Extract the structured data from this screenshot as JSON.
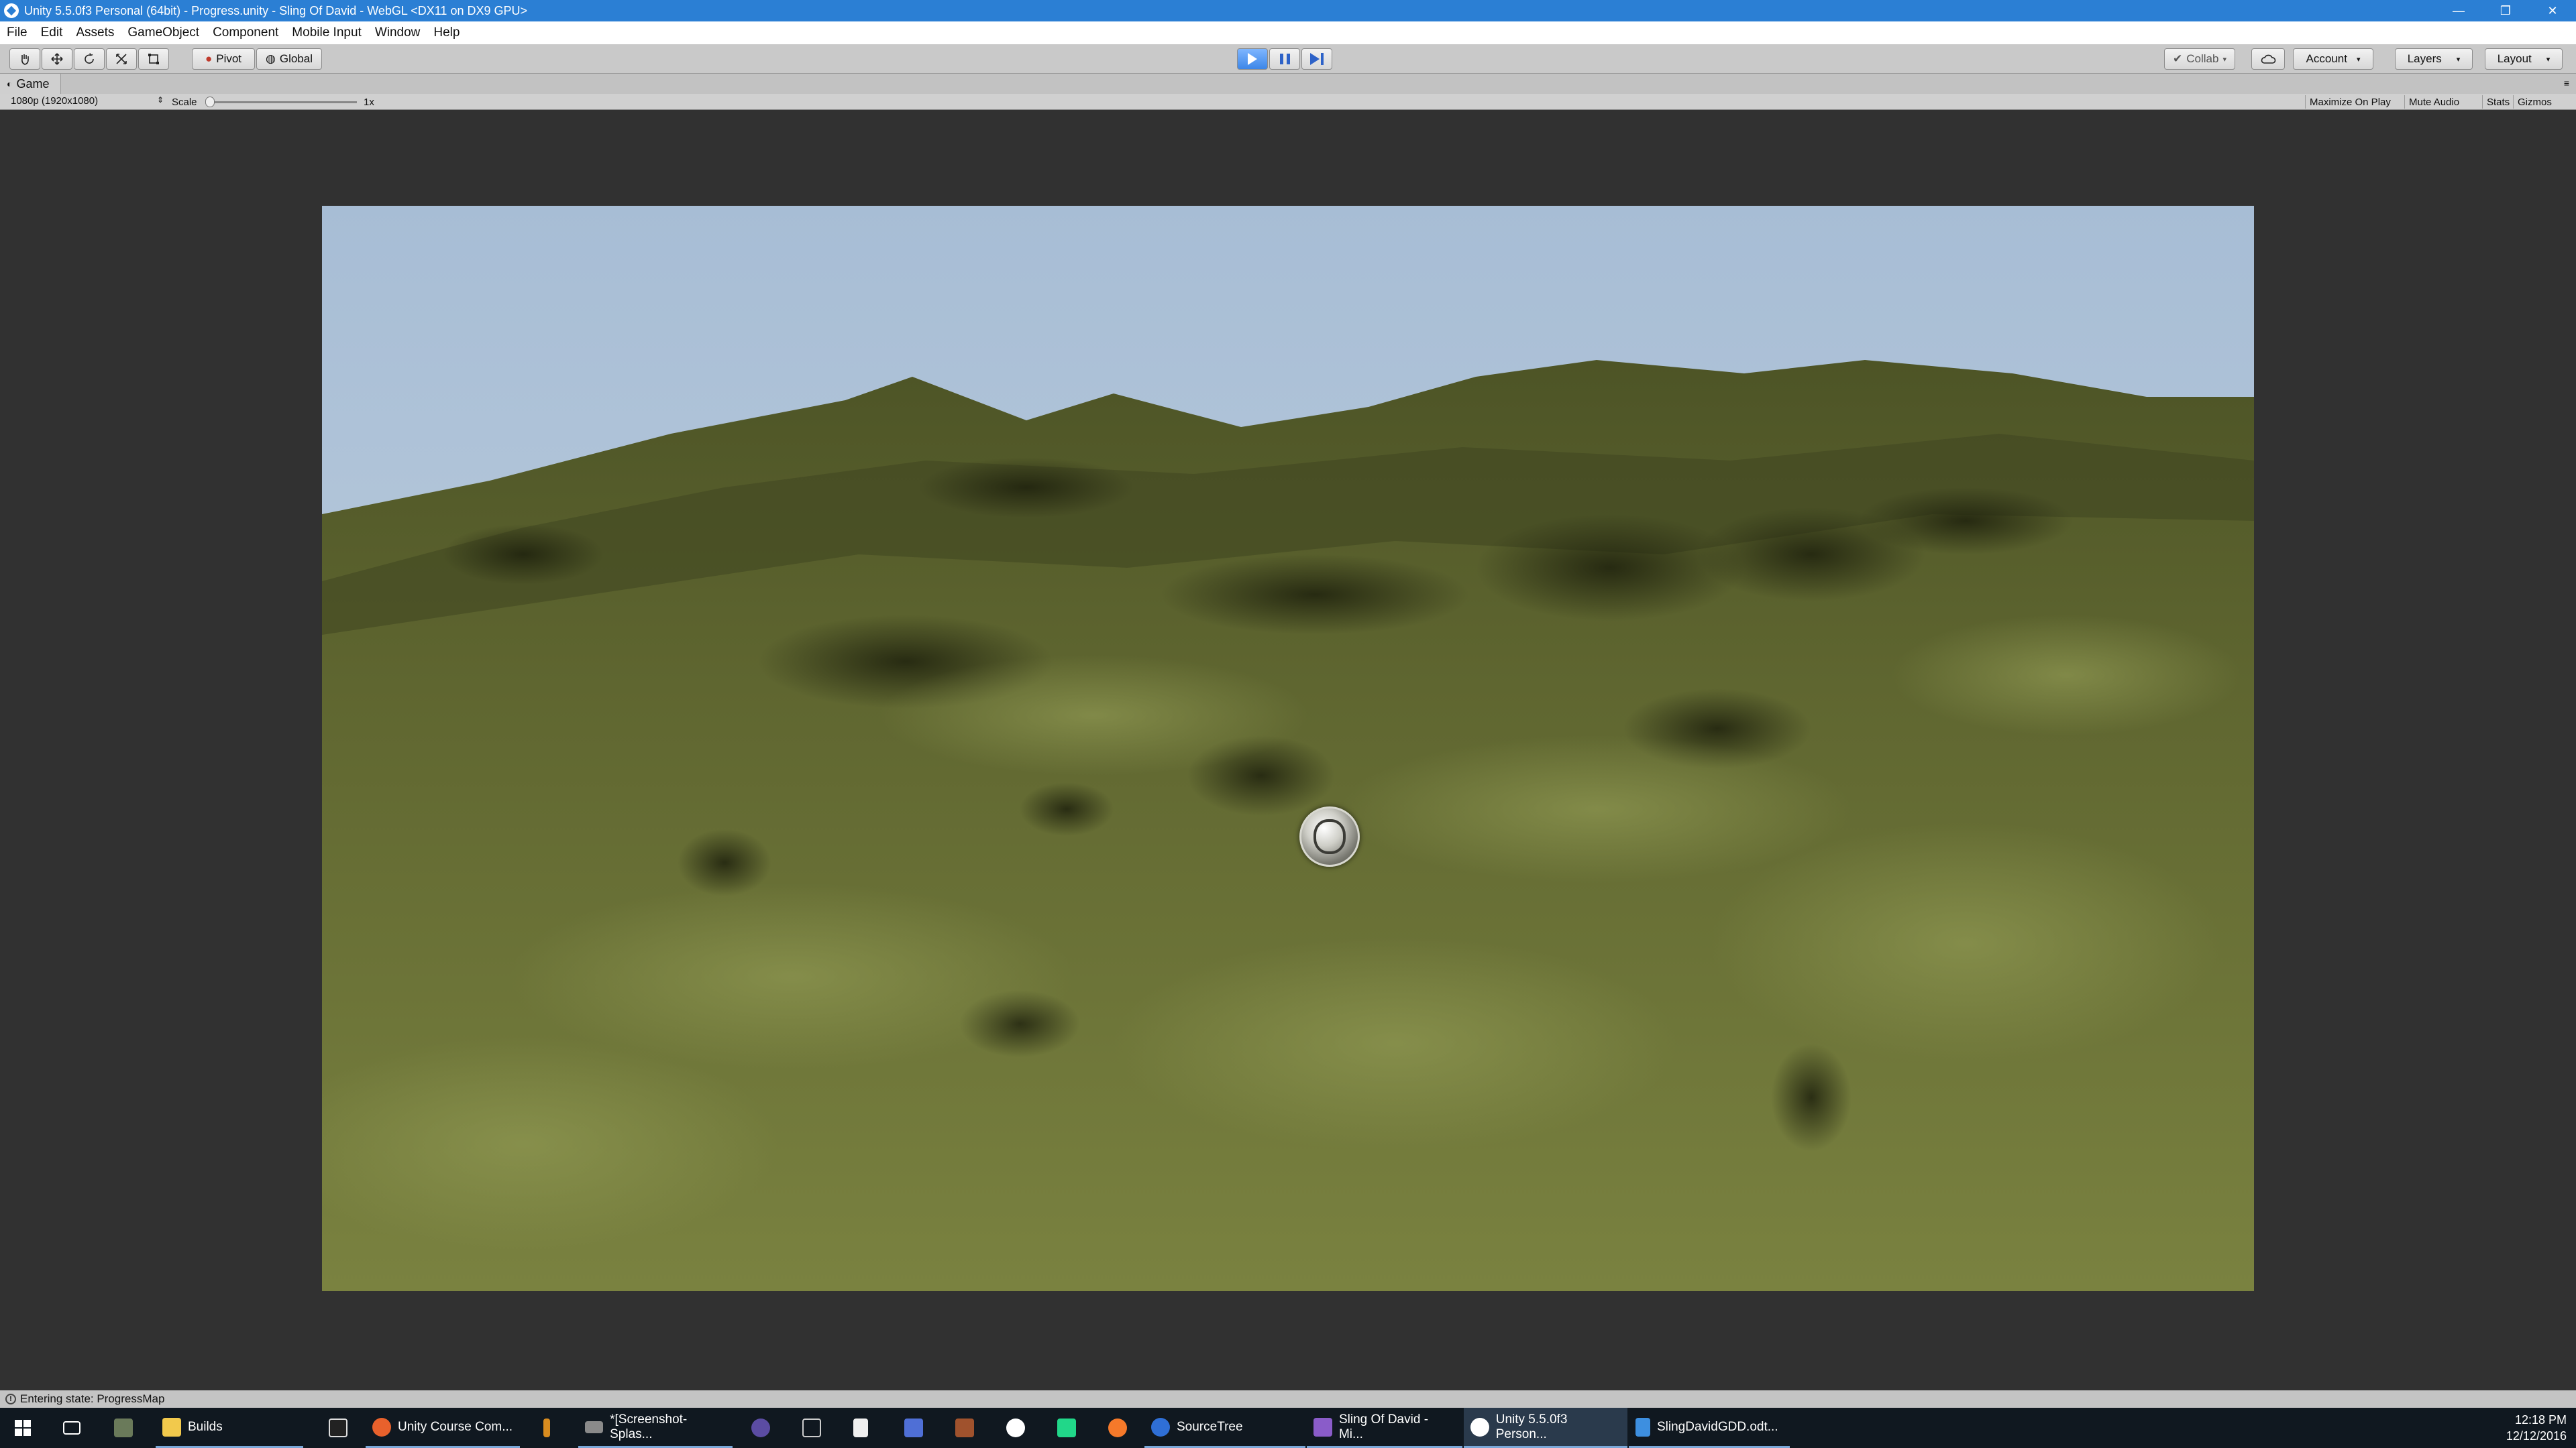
{
  "window": {
    "title": "Unity 5.5.0f3 Personal (64bit) - Progress.unity - Sling Of David - WebGL <DX11 on DX9 GPU>",
    "controls": [
      "—",
      "❐",
      "✕"
    ]
  },
  "menu": [
    "File",
    "Edit",
    "Assets",
    "GameObject",
    "Component",
    "Mobile Input",
    "Window",
    "Help"
  ],
  "toolbar": {
    "pivot_label": "Pivot",
    "global_label": "Global",
    "collab_label": "Collab",
    "account_label": "Account",
    "layers_label": "Layers",
    "layout_label": "Layout"
  },
  "game_view": {
    "tab_label": "Game",
    "resolution": "1080p (1920x1080)",
    "scale_label": "Scale",
    "scale_value": "1x",
    "right_buttons": [
      "Maximize On Play",
      "Mute Audio",
      "Stats",
      "Gizmos"
    ]
  },
  "status": {
    "message": "Entering state: ProgressMap"
  },
  "taskbar": {
    "items": [
      {
        "label": "Builds",
        "icon": "folder-icon",
        "color": "#f2c94c"
      },
      {
        "label": "Unity Course Com...",
        "icon": "firefox-icon",
        "color": "#e8612c"
      },
      {
        "label": "*[Screenshot-Splas...",
        "icon": "image-editor-icon",
        "color": "#8a8a8a"
      },
      {
        "label": "SourceTree",
        "icon": "sourcetree-icon",
        "color": "#2f6fd6"
      },
      {
        "label": "Sling Of David - Mi...",
        "icon": "visual-studio-icon",
        "color": "#8a5cc9"
      },
      {
        "label": "Unity 5.5.0f3 Person...",
        "icon": "unity-icon",
        "color": "#ffffff"
      },
      {
        "label": "SlingDavidGDD.odt...",
        "icon": "writer-icon",
        "color": "#3d8fe0"
      }
    ],
    "time": "12:18 PM",
    "date": "12/12/2016"
  },
  "colors": {
    "title_bar": "#2b7fd4",
    "sky": "#a9bfd6",
    "terrain": "#6f7735"
  }
}
